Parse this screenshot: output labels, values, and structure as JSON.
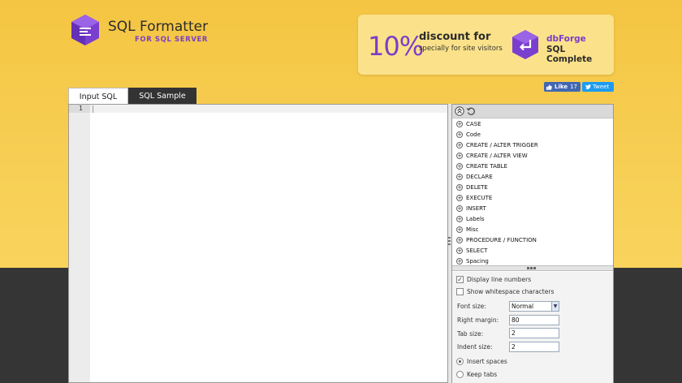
{
  "logo": {
    "title": "SQL Formatter",
    "subtitle": "FOR SQL SERVER"
  },
  "promo": {
    "percent": "10%",
    "headline": "discount for",
    "subline": "specially for site visitors",
    "brand": "dbForge",
    "product": "SQL Complete"
  },
  "social": {
    "like_label": "Like",
    "like_count": "17",
    "tweet_label": "Tweet"
  },
  "tabs": [
    {
      "label": "Input SQL"
    },
    {
      "label": "SQL Sample"
    }
  ],
  "editor": {
    "line_numbers": [
      "1"
    ],
    "content": ""
  },
  "tree": {
    "items": [
      {
        "label": "CASE"
      },
      {
        "label": "Code"
      },
      {
        "label": "CREATE / ALTER TRIGGER"
      },
      {
        "label": "CREATE / ALTER VIEW"
      },
      {
        "label": "CREATE TABLE"
      },
      {
        "label": "DECLARE"
      },
      {
        "label": "DELETE"
      },
      {
        "label": "EXECUTE"
      },
      {
        "label": "INSERT"
      },
      {
        "label": "Labels"
      },
      {
        "label": "Misc"
      },
      {
        "label": "PROCEDURE / FUNCTION"
      },
      {
        "label": "SELECT"
      },
      {
        "label": "Spacing"
      }
    ]
  },
  "options": {
    "display_line_numbers": {
      "label": "Display line numbers",
      "checked": true
    },
    "show_whitespace": {
      "label": "Show whitespace characters",
      "checked": false
    },
    "font_size": {
      "label": "Font size:",
      "value": "Normal"
    },
    "right_margin": {
      "label": "Right margin:",
      "value": "80"
    },
    "tab_size": {
      "label": "Tab size:",
      "value": "2"
    },
    "indent_size": {
      "label": "Indent size:",
      "value": "2"
    },
    "insert_spaces": {
      "label": "Insert spaces",
      "selected": true
    },
    "keep_tabs": {
      "label": "Keep tabs",
      "selected": false
    }
  },
  "colors": {
    "brand_purple": "#7a3dc8",
    "background_yellow": "#f7cf55",
    "dark_band": "#353535"
  }
}
